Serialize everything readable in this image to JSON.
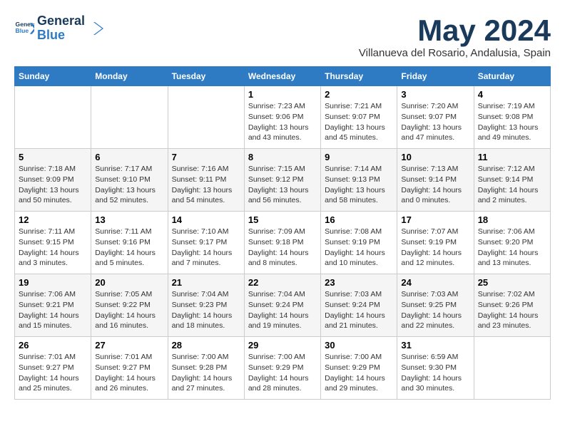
{
  "header": {
    "logo_general": "General",
    "logo_blue": "Blue",
    "month_title": "May 2024",
    "location": "Villanueva del Rosario, Andalusia, Spain"
  },
  "weekdays": [
    "Sunday",
    "Monday",
    "Tuesday",
    "Wednesday",
    "Thursday",
    "Friday",
    "Saturday"
  ],
  "weeks": [
    [
      {
        "day": "",
        "info": ""
      },
      {
        "day": "",
        "info": ""
      },
      {
        "day": "",
        "info": ""
      },
      {
        "day": "1",
        "info": "Sunrise: 7:23 AM\nSunset: 9:06 PM\nDaylight: 13 hours\nand 43 minutes."
      },
      {
        "day": "2",
        "info": "Sunrise: 7:21 AM\nSunset: 9:07 PM\nDaylight: 13 hours\nand 45 minutes."
      },
      {
        "day": "3",
        "info": "Sunrise: 7:20 AM\nSunset: 9:07 PM\nDaylight: 13 hours\nand 47 minutes."
      },
      {
        "day": "4",
        "info": "Sunrise: 7:19 AM\nSunset: 9:08 PM\nDaylight: 13 hours\nand 49 minutes."
      }
    ],
    [
      {
        "day": "5",
        "info": "Sunrise: 7:18 AM\nSunset: 9:09 PM\nDaylight: 13 hours\nand 50 minutes."
      },
      {
        "day": "6",
        "info": "Sunrise: 7:17 AM\nSunset: 9:10 PM\nDaylight: 13 hours\nand 52 minutes."
      },
      {
        "day": "7",
        "info": "Sunrise: 7:16 AM\nSunset: 9:11 PM\nDaylight: 13 hours\nand 54 minutes."
      },
      {
        "day": "8",
        "info": "Sunrise: 7:15 AM\nSunset: 9:12 PM\nDaylight: 13 hours\nand 56 minutes."
      },
      {
        "day": "9",
        "info": "Sunrise: 7:14 AM\nSunset: 9:13 PM\nDaylight: 13 hours\nand 58 minutes."
      },
      {
        "day": "10",
        "info": "Sunrise: 7:13 AM\nSunset: 9:14 PM\nDaylight: 14 hours\nand 0 minutes."
      },
      {
        "day": "11",
        "info": "Sunrise: 7:12 AM\nSunset: 9:14 PM\nDaylight: 14 hours\nand 2 minutes."
      }
    ],
    [
      {
        "day": "12",
        "info": "Sunrise: 7:11 AM\nSunset: 9:15 PM\nDaylight: 14 hours\nand 3 minutes."
      },
      {
        "day": "13",
        "info": "Sunrise: 7:11 AM\nSunset: 9:16 PM\nDaylight: 14 hours\nand 5 minutes."
      },
      {
        "day": "14",
        "info": "Sunrise: 7:10 AM\nSunset: 9:17 PM\nDaylight: 14 hours\nand 7 minutes."
      },
      {
        "day": "15",
        "info": "Sunrise: 7:09 AM\nSunset: 9:18 PM\nDaylight: 14 hours\nand 8 minutes."
      },
      {
        "day": "16",
        "info": "Sunrise: 7:08 AM\nSunset: 9:19 PM\nDaylight: 14 hours\nand 10 minutes."
      },
      {
        "day": "17",
        "info": "Sunrise: 7:07 AM\nSunset: 9:19 PM\nDaylight: 14 hours\nand 12 minutes."
      },
      {
        "day": "18",
        "info": "Sunrise: 7:06 AM\nSunset: 9:20 PM\nDaylight: 14 hours\nand 13 minutes."
      }
    ],
    [
      {
        "day": "19",
        "info": "Sunrise: 7:06 AM\nSunset: 9:21 PM\nDaylight: 14 hours\nand 15 minutes."
      },
      {
        "day": "20",
        "info": "Sunrise: 7:05 AM\nSunset: 9:22 PM\nDaylight: 14 hours\nand 16 minutes."
      },
      {
        "day": "21",
        "info": "Sunrise: 7:04 AM\nSunset: 9:23 PM\nDaylight: 14 hours\nand 18 minutes."
      },
      {
        "day": "22",
        "info": "Sunrise: 7:04 AM\nSunset: 9:24 PM\nDaylight: 14 hours\nand 19 minutes."
      },
      {
        "day": "23",
        "info": "Sunrise: 7:03 AM\nSunset: 9:24 PM\nDaylight: 14 hours\nand 21 minutes."
      },
      {
        "day": "24",
        "info": "Sunrise: 7:03 AM\nSunset: 9:25 PM\nDaylight: 14 hours\nand 22 minutes."
      },
      {
        "day": "25",
        "info": "Sunrise: 7:02 AM\nSunset: 9:26 PM\nDaylight: 14 hours\nand 23 minutes."
      }
    ],
    [
      {
        "day": "26",
        "info": "Sunrise: 7:01 AM\nSunset: 9:27 PM\nDaylight: 14 hours\nand 25 minutes."
      },
      {
        "day": "27",
        "info": "Sunrise: 7:01 AM\nSunset: 9:27 PM\nDaylight: 14 hours\nand 26 minutes."
      },
      {
        "day": "28",
        "info": "Sunrise: 7:00 AM\nSunset: 9:28 PM\nDaylight: 14 hours\nand 27 minutes."
      },
      {
        "day": "29",
        "info": "Sunrise: 7:00 AM\nSunset: 9:29 PM\nDaylight: 14 hours\nand 28 minutes."
      },
      {
        "day": "30",
        "info": "Sunrise: 7:00 AM\nSunset: 9:29 PM\nDaylight: 14 hours\nand 29 minutes."
      },
      {
        "day": "31",
        "info": "Sunrise: 6:59 AM\nSunset: 9:30 PM\nDaylight: 14 hours\nand 30 minutes."
      },
      {
        "day": "",
        "info": ""
      }
    ]
  ]
}
